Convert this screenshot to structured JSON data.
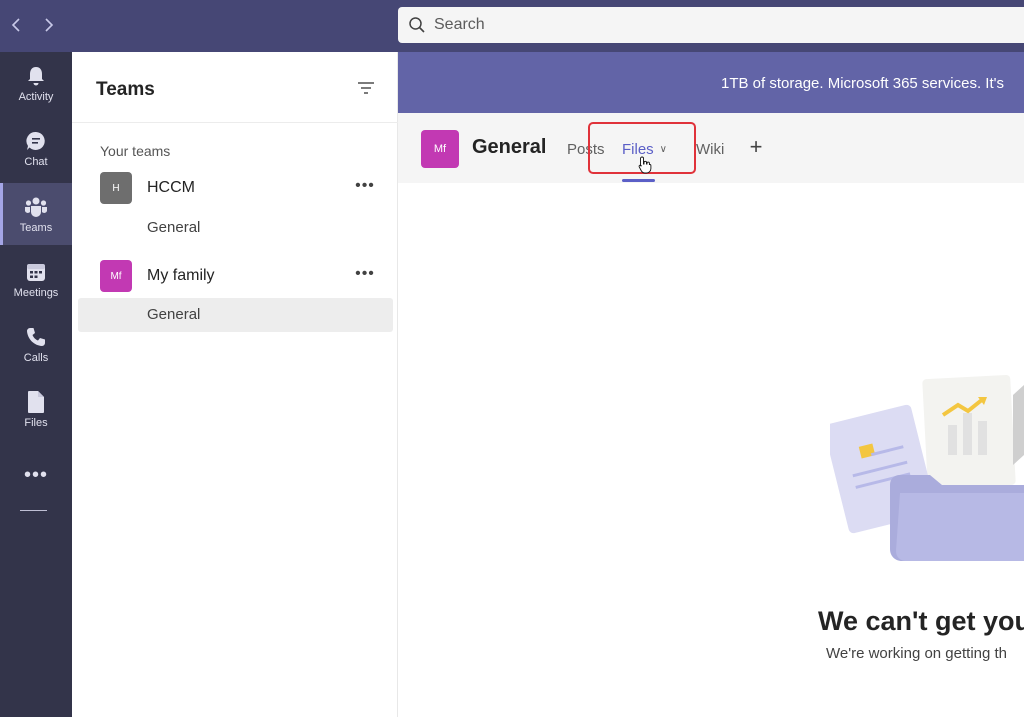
{
  "search": {
    "placeholder": "Search"
  },
  "rail": {
    "items": [
      {
        "label": "Activity",
        "icon": "bell-icon"
      },
      {
        "label": "Chat",
        "icon": "chat-icon"
      },
      {
        "label": "Teams",
        "icon": "teams-icon",
        "active": true
      },
      {
        "label": "Meetings",
        "icon": "calendar-icon"
      },
      {
        "label": "Calls",
        "icon": "phone-icon"
      },
      {
        "label": "Files",
        "icon": "file-icon"
      }
    ],
    "more_label": "•••"
  },
  "panel": {
    "title": "Teams",
    "section_label": "Your teams",
    "teams": [
      {
        "avatar": "H",
        "avatar_color": "#6e6e6e",
        "name": "HCCM",
        "channels": [
          "General"
        ]
      },
      {
        "avatar": "Mf",
        "avatar_color": "#c239b3",
        "name": "My family",
        "channels": [
          "General"
        ],
        "selected_channel": "General"
      }
    ],
    "more_label": "•••"
  },
  "banner": {
    "text": "1TB of storage. Microsoft 365 services. It's"
  },
  "channel": {
    "avatar": "Mf",
    "avatar_color": "#c239b3",
    "title": "General",
    "tabs": [
      {
        "label": "Posts"
      },
      {
        "label": "Files",
        "active": true
      },
      {
        "label": "Wiki"
      }
    ],
    "add_tab": "+"
  },
  "empty_state": {
    "title": "We can't get you",
    "subtitle": "We're working on getting th"
  },
  "colors": {
    "accent": "#5b5fc7",
    "highlight": "#e0323a",
    "topbar": "#464775",
    "rail": "#33344a",
    "banner": "#6264a7"
  }
}
